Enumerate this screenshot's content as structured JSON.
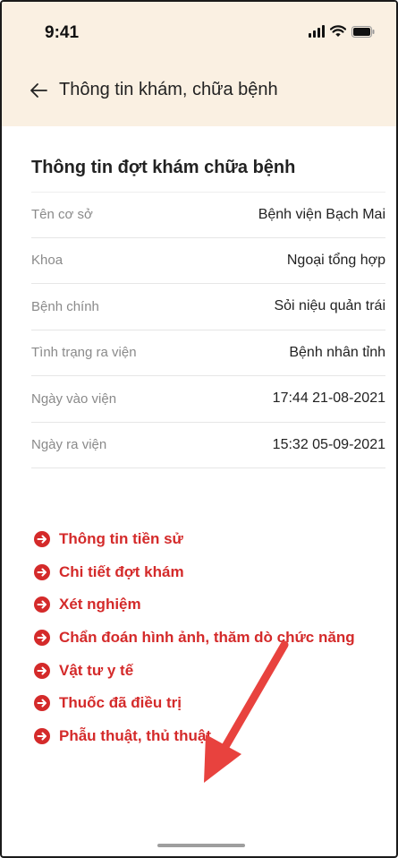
{
  "status_bar": {
    "time": "9:41",
    "icons": [
      "signal-icon",
      "wifi-icon",
      "battery-icon"
    ]
  },
  "header": {
    "title": "Thông tin khám, chữa bệnh",
    "back_icon": "arrow-left-icon"
  },
  "section": {
    "title": "Thông tin đợt khám chữa bệnh",
    "rows": [
      {
        "label": "Tên cơ sở",
        "value": "Bệnh viện Bạch Mai"
      },
      {
        "label": "Khoa",
        "value": "Ngoại tổng hợp"
      },
      {
        "label": "Bệnh chính",
        "value": "Sỏi niệu quản trái"
      },
      {
        "label": "Tình trạng ra viện",
        "value": "Bệnh nhân tỉnh"
      },
      {
        "label": "Ngày vào viện",
        "value": "17:44 21-08-2021"
      },
      {
        "label": "Ngày ra viện",
        "value": "15:32 05-09-2021"
      }
    ]
  },
  "links": [
    {
      "label": "Thông tin tiền sử",
      "icon": "arrow-circle-right-icon"
    },
    {
      "label": "Chi tiết đợt khám",
      "icon": "arrow-circle-right-icon"
    },
    {
      "label": "Xét nghiệm",
      "icon": "arrow-circle-right-icon"
    },
    {
      "label": "Chẩn đoán hình ảnh, thăm dò chức năng",
      "icon": "arrow-circle-right-icon"
    },
    {
      "label": "Vật tư y tế",
      "icon": "arrow-circle-right-icon"
    },
    {
      "label": "Thuốc đã điều trị",
      "icon": "arrow-circle-right-icon"
    },
    {
      "label": "Phẫu thuật, thủ thuật",
      "icon": "arrow-circle-right-icon"
    }
  ],
  "colors": {
    "header_bg": "#faf0e2",
    "accent_red": "#d42a2a",
    "annotation_arrow": "#e8423e"
  }
}
